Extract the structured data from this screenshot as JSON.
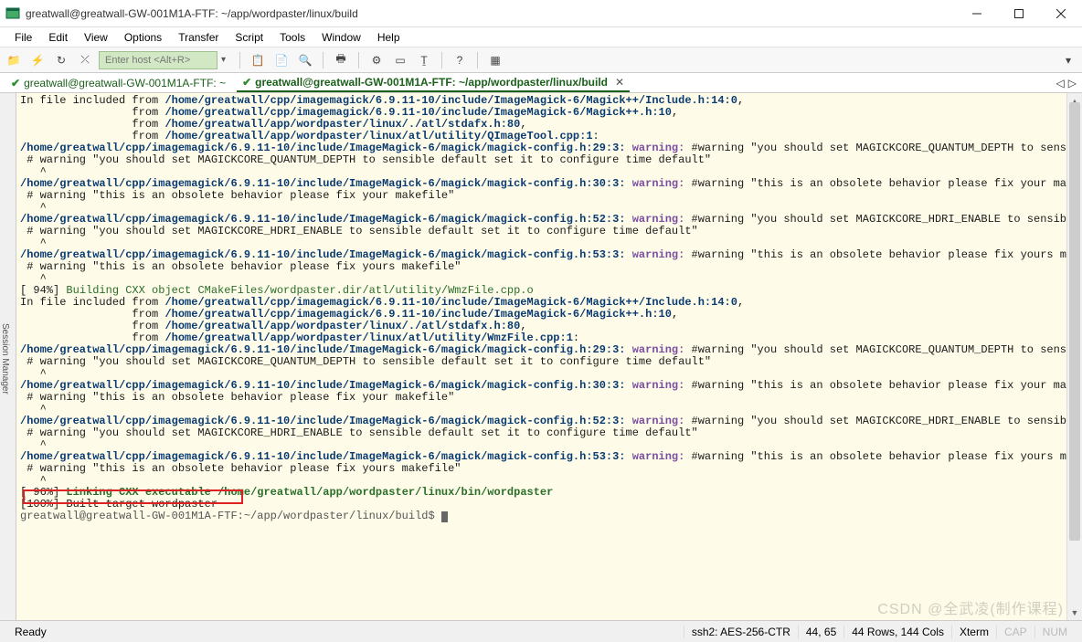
{
  "titlebar": {
    "title": "greatwall@greatwall-GW-001M1A-FTF: ~/app/wordpaster/linux/build"
  },
  "menubar": [
    "File",
    "Edit",
    "View",
    "Options",
    "Transfer",
    "Script",
    "Tools",
    "Window",
    "Help"
  ],
  "toolbar": {
    "host_placeholder": "Enter host <Alt+R>"
  },
  "tabs": {
    "items": [
      {
        "label": "greatwall@greatwall-GW-001M1A-FTF: ~",
        "active": false
      },
      {
        "label": "greatwall@greatwall-GW-001M1A-FTF: ~/app/wordpaster/linux/build",
        "active": true
      }
    ]
  },
  "side_panel": "Session Manager",
  "terminal": {
    "block1": {
      "l1": "In file included from ",
      "p1": "/home/greatwall/cpp/imagemagick/6.9.11-10/include/ImageMagick-6/Magick++/Include.h:14:0",
      "l2": ",",
      "l3": "                 from ",
      "p2": "/home/greatwall/cpp/imagemagick/6.9.11-10/include/ImageMagick-6/Magick++.h:10",
      "l4": ",",
      "l5": "                 from ",
      "p3": "/home/greatwall/app/wordpaster/linux/./atl/stdafx.h:80",
      "l6": ",",
      "l7": "                 from ",
      "p4": "/home/greatwall/app/wordpaster/linux/atl/utility/QImageTool.cpp:1",
      "l8": ":"
    },
    "w1": {
      "path": "/home/greatwall/cpp/imagemagick/6.9.11-10/include/ImageMagick-6/magick/magick-config.h:29:3:",
      "kw": "warning:",
      "msg": " #warning \"you should set MAGICKCORE_QUANTUM_DEPTH to sensible default set it to configure time default\" [-Wcpp]",
      "det": " # warning \"you should set MAGICKCORE_QUANTUM_DEPTH to sensible default set it to configure time default\"",
      "caret": "   ^"
    },
    "w2": {
      "path": "/home/greatwall/cpp/imagemagick/6.9.11-10/include/ImageMagick-6/magick/magick-config.h:30:3:",
      "kw": "warning:",
      "msg": " #warning \"this is an obsolete behavior please fix your makefile\" [-Wcpp]",
      "det": " # warning \"this is an obsolete behavior please fix your makefile\"",
      "caret": "   ^"
    },
    "w3": {
      "path": "/home/greatwall/cpp/imagemagick/6.9.11-10/include/ImageMagick-6/magick/magick-config.h:52:3:",
      "kw": "warning:",
      "msg": " #warning \"you should set MAGICKCORE_HDRI_ENABLE to sensible default set it to configure time default\" [-Wcpp]",
      "det": " # warning \"you should set MAGICKCORE_HDRI_ENABLE to sensible default set it to configure time default\"",
      "caret": "   ^"
    },
    "w4": {
      "path": "/home/greatwall/cpp/imagemagick/6.9.11-10/include/ImageMagick-6/magick/magick-config.h:53:3:",
      "kw": "warning:",
      "msg": " #warning \"this is an obsolete behavior please fix yours makefile\" [-Wcpp]",
      "det": " # warning \"this is an obsolete behavior please fix yours makefile\"",
      "caret": "   ^"
    },
    "build94_pct": "[ 94%] ",
    "build94": "Building CXX object CMakeFiles/wordpaster.dir/atl/utility/WmzFile.cpp.o",
    "block2": {
      "l1": "In file included from ",
      "p1": "/home/greatwall/cpp/imagemagick/6.9.11-10/include/ImageMagick-6/Magick++/Include.h:14:0",
      "l2": ",",
      "l3": "                 from ",
      "p2": "/home/greatwall/cpp/imagemagick/6.9.11-10/include/ImageMagick-6/Magick++.h:10",
      "l4": ",",
      "l5": "                 from ",
      "p3": "/home/greatwall/app/wordpaster/linux/./atl/stdafx.h:80",
      "l6": ",",
      "l7": "                 from ",
      "p4": "/home/greatwall/app/wordpaster/linux/atl/utility/WmzFile.cpp:1",
      "l8": ":"
    },
    "link96_pct": "[ 96%] ",
    "link96a": "Linking CXX executable ",
    "link96b": "/home/greatwall/app/wordpaster/linux/bin/wordpaster",
    "built100": "[100%] Built target wordpaster",
    "prompt": "greatwall@greatwall-GW-001M1A-FTF:~/app/wordpaster/linux/build$ "
  },
  "statusbar": {
    "ready": "Ready",
    "cipher": "ssh2: AES-256-CTR",
    "cursor": "44,  65",
    "size": "44 Rows, 144 Cols",
    "term": "Xterm",
    "caps": "CAP",
    "num": "NUM"
  },
  "watermark": "CSDN @全武凌(制作课程)"
}
